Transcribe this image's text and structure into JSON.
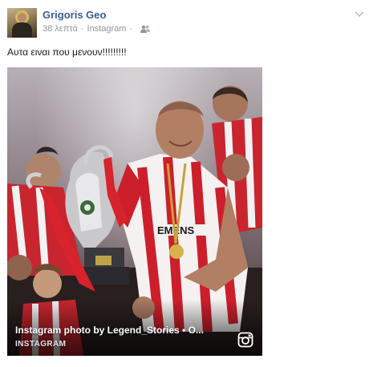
{
  "post": {
    "author": "Grigoris Geo",
    "timestamp": "38 λεπτά",
    "separator": "·",
    "source": "Instagram",
    "audience_icon": "friends-icon",
    "menu_icon": "chevron-down-icon",
    "message": "Αυτα ειναι που μενουν!!!!!!!!!"
  },
  "attachment": {
    "title": "Instagram photo by Legend_Stories • O...",
    "source_label": "INSTAGRAM",
    "source_icon": "instagram-icon"
  },
  "colors": {
    "author_link": "#3b5998",
    "meta_text": "#90949c",
    "body_text": "#141823"
  }
}
